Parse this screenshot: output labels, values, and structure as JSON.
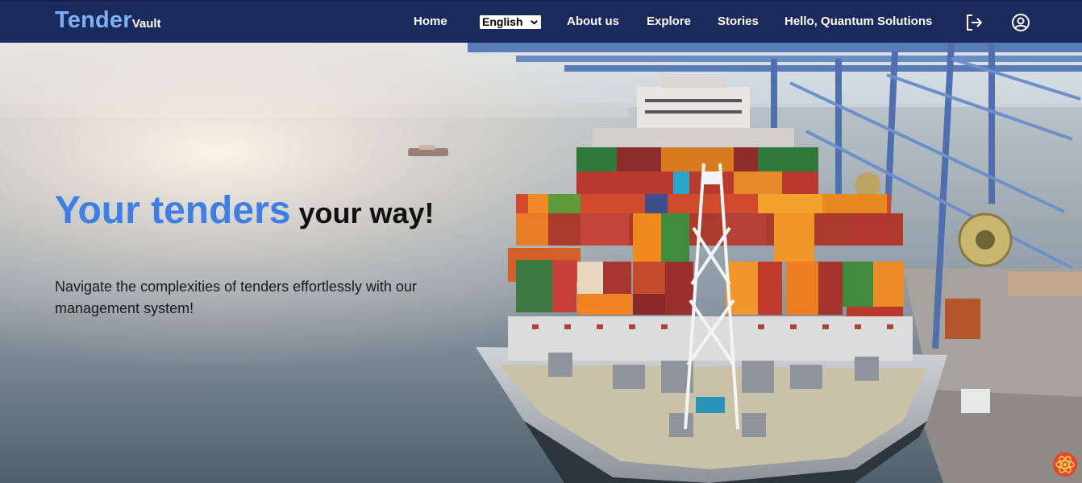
{
  "navbar": {
    "brand_main": "Tender",
    "brand_sub": "Vault",
    "home": "Home",
    "language": "English",
    "about": "About us",
    "explore": "Explore",
    "stories": "Stories",
    "greeting": "Hello, Quantum Solutions",
    "logout_icon": "logout-icon",
    "profile_icon": "user-circle-icon"
  },
  "hero": {
    "title_accent": "Your tenders",
    "title_rest": " your way!",
    "description": "Navigate the complexities of tenders effortlessly with our management system!"
  },
  "colors": {
    "navbar": "#1b2a5c",
    "accent": "#3d7fe6",
    "brand": "#7fb0f5"
  }
}
